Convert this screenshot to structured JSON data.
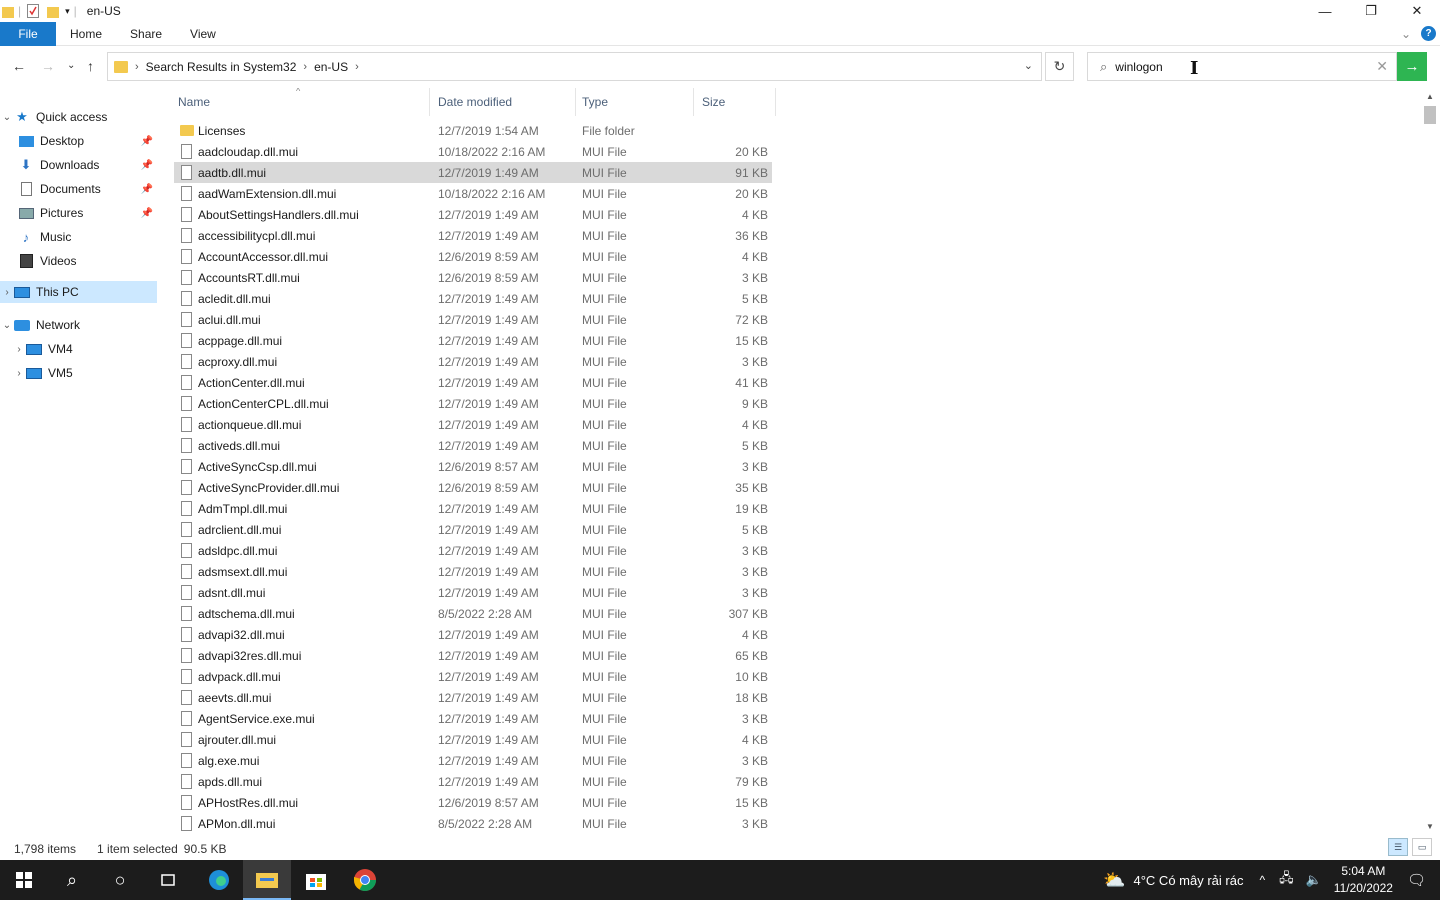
{
  "window": {
    "title": "en-US",
    "minimize": "—",
    "maximize": "❐",
    "close": "✕"
  },
  "ribbon": {
    "file": "File",
    "home": "Home",
    "share": "Share",
    "view": "View",
    "expand": "⌄",
    "help": "?"
  },
  "nav": {
    "back": "←",
    "forward": "→",
    "recent": "⌄",
    "up": "↑"
  },
  "address": {
    "crumbs": [
      "Search Results in System32",
      "en-US"
    ],
    "sep": "›",
    "dropdown": "⌄"
  },
  "refresh": "↻",
  "search": {
    "value": "winlogon",
    "icon": "⌕",
    "clear": "✕",
    "go": "→"
  },
  "cursor": "I",
  "sidebar": {
    "quick_access": "Quick access",
    "desktop": "Desktop",
    "downloads": "Downloads",
    "documents": "Documents",
    "pictures": "Pictures",
    "music": "Music",
    "videos": "Videos",
    "this_pc": "This PC",
    "network": "Network",
    "vm4": "VM4",
    "vm5": "VM5"
  },
  "columns": {
    "name": "Name",
    "date": "Date modified",
    "type": "Type",
    "size": "Size"
  },
  "files": [
    {
      "name": "Licenses",
      "date": "12/7/2019 1:54 AM",
      "type": "File folder",
      "size": "",
      "folder": true
    },
    {
      "name": "aadcloudap.dll.mui",
      "date": "10/18/2022 2:16 AM",
      "type": "MUI File",
      "size": "20 KB"
    },
    {
      "name": "aadtb.dll.mui",
      "date": "12/7/2019 1:49 AM",
      "type": "MUI File",
      "size": "91 KB",
      "selected": true
    },
    {
      "name": "aadWamExtension.dll.mui",
      "date": "10/18/2022 2:16 AM",
      "type": "MUI File",
      "size": "20 KB"
    },
    {
      "name": "AboutSettingsHandlers.dll.mui",
      "date": "12/7/2019 1:49 AM",
      "type": "MUI File",
      "size": "4 KB"
    },
    {
      "name": "accessibilitycpl.dll.mui",
      "date": "12/7/2019 1:49 AM",
      "type": "MUI File",
      "size": "36 KB"
    },
    {
      "name": "AccountAccessor.dll.mui",
      "date": "12/6/2019 8:59 AM",
      "type": "MUI File",
      "size": "4 KB"
    },
    {
      "name": "AccountsRT.dll.mui",
      "date": "12/6/2019 8:59 AM",
      "type": "MUI File",
      "size": "3 KB"
    },
    {
      "name": "acledit.dll.mui",
      "date": "12/7/2019 1:49 AM",
      "type": "MUI File",
      "size": "5 KB"
    },
    {
      "name": "aclui.dll.mui",
      "date": "12/7/2019 1:49 AM",
      "type": "MUI File",
      "size": "72 KB"
    },
    {
      "name": "acppage.dll.mui",
      "date": "12/7/2019 1:49 AM",
      "type": "MUI File",
      "size": "15 KB"
    },
    {
      "name": "acproxy.dll.mui",
      "date": "12/7/2019 1:49 AM",
      "type": "MUI File",
      "size": "3 KB"
    },
    {
      "name": "ActionCenter.dll.mui",
      "date": "12/7/2019 1:49 AM",
      "type": "MUI File",
      "size": "41 KB"
    },
    {
      "name": "ActionCenterCPL.dll.mui",
      "date": "12/7/2019 1:49 AM",
      "type": "MUI File",
      "size": "9 KB"
    },
    {
      "name": "actionqueue.dll.mui",
      "date": "12/7/2019 1:49 AM",
      "type": "MUI File",
      "size": "4 KB"
    },
    {
      "name": "activeds.dll.mui",
      "date": "12/7/2019 1:49 AM",
      "type": "MUI File",
      "size": "5 KB"
    },
    {
      "name": "ActiveSyncCsp.dll.mui",
      "date": "12/6/2019 8:57 AM",
      "type": "MUI File",
      "size": "3 KB"
    },
    {
      "name": "ActiveSyncProvider.dll.mui",
      "date": "12/6/2019 8:59 AM",
      "type": "MUI File",
      "size": "35 KB"
    },
    {
      "name": "AdmTmpl.dll.mui",
      "date": "12/7/2019 1:49 AM",
      "type": "MUI File",
      "size": "19 KB"
    },
    {
      "name": "adrclient.dll.mui",
      "date": "12/7/2019 1:49 AM",
      "type": "MUI File",
      "size": "5 KB"
    },
    {
      "name": "adsldpc.dll.mui",
      "date": "12/7/2019 1:49 AM",
      "type": "MUI File",
      "size": "3 KB"
    },
    {
      "name": "adsmsext.dll.mui",
      "date": "12/7/2019 1:49 AM",
      "type": "MUI File",
      "size": "3 KB"
    },
    {
      "name": "adsnt.dll.mui",
      "date": "12/7/2019 1:49 AM",
      "type": "MUI File",
      "size": "3 KB"
    },
    {
      "name": "adtschema.dll.mui",
      "date": "8/5/2022 2:28 AM",
      "type": "MUI File",
      "size": "307 KB"
    },
    {
      "name": "advapi32.dll.mui",
      "date": "12/7/2019 1:49 AM",
      "type": "MUI File",
      "size": "4 KB"
    },
    {
      "name": "advapi32res.dll.mui",
      "date": "12/7/2019 1:49 AM",
      "type": "MUI File",
      "size": "65 KB"
    },
    {
      "name": "advpack.dll.mui",
      "date": "12/7/2019 1:49 AM",
      "type": "MUI File",
      "size": "10 KB"
    },
    {
      "name": "aeevts.dll.mui",
      "date": "12/7/2019 1:49 AM",
      "type": "MUI File",
      "size": "18 KB"
    },
    {
      "name": "AgentService.exe.mui",
      "date": "12/7/2019 1:49 AM",
      "type": "MUI File",
      "size": "3 KB"
    },
    {
      "name": "ajrouter.dll.mui",
      "date": "12/7/2019 1:49 AM",
      "type": "MUI File",
      "size": "4 KB"
    },
    {
      "name": "alg.exe.mui",
      "date": "12/7/2019 1:49 AM",
      "type": "MUI File",
      "size": "3 KB"
    },
    {
      "name": "apds.dll.mui",
      "date": "12/7/2019 1:49 AM",
      "type": "MUI File",
      "size": "79 KB"
    },
    {
      "name": "APHostRes.dll.mui",
      "date": "12/6/2019 8:57 AM",
      "type": "MUI File",
      "size": "15 KB"
    },
    {
      "name": "APMon.dll.mui",
      "date": "8/5/2022 2:28 AM",
      "type": "MUI File",
      "size": "3 KB"
    }
  ],
  "status": {
    "items": "1,798 items",
    "selected": "1 item selected",
    "size": "90.5 KB"
  },
  "taskbar": {
    "weather": "4°C  Có mây rải rác",
    "time": "5:04 AM",
    "date": "11/20/2022"
  },
  "colors": {
    "accent": "#1979ca",
    "search_go": "#2eb552",
    "selection": "#cce8ff",
    "row_selected": "#d9d9d9"
  }
}
